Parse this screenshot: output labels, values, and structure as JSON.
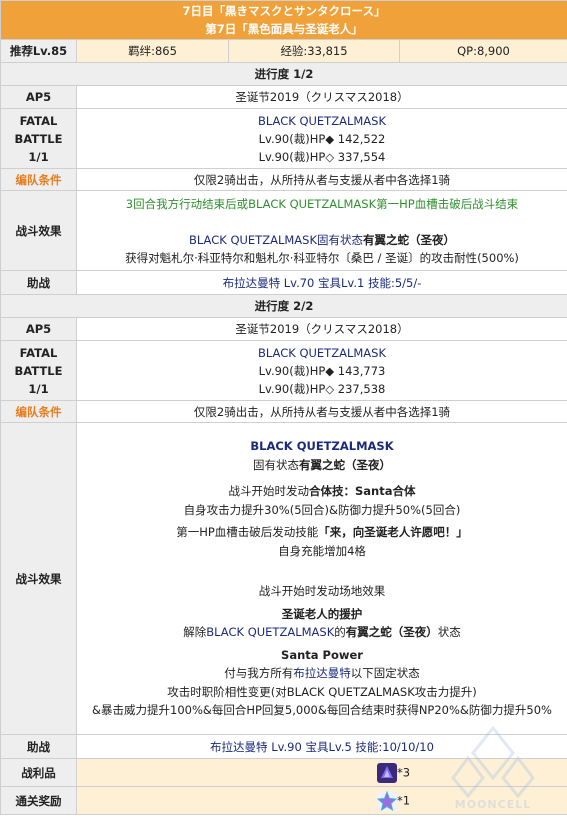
{
  "header": {
    "line1": "7日目「黒きマスクとサンタクロース」",
    "line2": "第7日「黑色面具与圣诞老人」"
  },
  "info": {
    "level_label": "推荐Lv.85",
    "bond": "羁绊:865",
    "exp": "经验:33,815",
    "qp": "QP:8,900"
  },
  "progress1": {
    "title": "进行度 1/2",
    "ap_label": "AP5",
    "event": "圣诞节2019（クリスマス2018）",
    "battle_label_1": "FATAL",
    "battle_label_2": "BATTLE",
    "battle_label_3": "1/1",
    "enemy_name": "BLACK QUETZALMASK",
    "enemy_hp1": "Lv.90(裁)HP◆ 142,522",
    "enemy_hp2": "Lv.90(裁)HP◇ 337,554",
    "party_label": "编队条件",
    "party_text": "仅限2骑出击，从所持从者与支援从者中各选择1骑",
    "effect_label": "战斗效果",
    "effect_green": "3回合我方行动结束后或BLACK QUETZALMASK第一HP血槽击破后战斗结束",
    "effect_a_pre": "BLACK QUETZALMASK固有状态",
    "effect_a_bold": "有翼之蛇（圣夜）",
    "effect_b": "获得对魁札尔·科亚特尔和魁札尔·科亚特尔〔桑巴 / 圣诞〕的攻击耐性(500%)",
    "support_label": "助战",
    "support_text": "布拉达曼特 Lv.70 宝具Lv.1 技能:5/5/-"
  },
  "progress2": {
    "title": "进行度 2/2",
    "ap_label": "AP5",
    "event": "圣诞节2019（クリスマス2018）",
    "battle_label_1": "FATAL",
    "battle_label_2": "BATTLE",
    "battle_label_3": "1/1",
    "enemy_name": "BLACK QUETZALMASK",
    "enemy_hp1": "Lv.90(裁)HP◆ 143,773",
    "enemy_hp2": "Lv.90(裁)HP◇ 237,538",
    "party_label": "编队条件",
    "party_text": "仅限2骑出击，从所持从者与支援从者中各选择1骑",
    "effect_label": "战斗效果",
    "e_title": "BLACK QUETZALMASK",
    "e_state_pre": "固有状态",
    "e_state_bold": "有翼之蛇（圣夜）",
    "e_start_pre": "战斗开始时发动",
    "e_start_bold": "合体技：Santa合体",
    "e_start_desc": "自身攻击力提升30%(5回合)&防御力提升50%(5回合)",
    "e_break_pre": "第一HP血槽击破后发动技能",
    "e_break_bold": "「来，向圣诞老人许愿吧！」",
    "e_break_desc": "自身充能增加4格",
    "e_field": "战斗开始时发动场地效果",
    "e_help_bold": "圣诞老人的援护",
    "e_help_pre": "解除",
    "e_help_blue": "BLACK QUETZALMASK",
    "e_help_mid": "的",
    "e_help_bold2": "有翼之蛇（圣夜）",
    "e_help_post": "状态",
    "e_power_title": "Santa Power",
    "e_power_1_pre": "付与我方所有",
    "e_power_1_link": "布拉达曼特",
    "e_power_1_post": "以下固定状态",
    "e_power_2": "攻击时职阶相性变更(对BLACK QUETZALMASK攻击力提升)",
    "e_power_3": "&暴击威力提升100%&每回合HP回复5,000&每回合结束时获得NP20%&防御力提升50%",
    "support_label": "助战",
    "support_text": "布拉达曼特 Lv.90 宝具Lv.5 技能:10/10/10"
  },
  "rewards": {
    "drop_label": "战利品",
    "drop_count": "*3",
    "clear_label": "通关奖励",
    "clear_count": "*1"
  },
  "watermark_text": "MOONCELL"
}
